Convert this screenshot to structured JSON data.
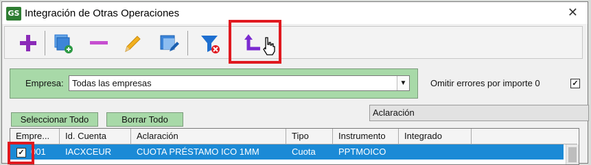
{
  "window": {
    "app_icon_text": "GS",
    "title": "Integración de Otras Operaciones",
    "close_glyph": "✕"
  },
  "toolbar": {
    "buttons": [
      {
        "name": "add",
        "icon": "plus-icon",
        "color": "#8b2bb8"
      },
      {
        "name": "duplicate",
        "icon": "copy-add-icon",
        "color": "#1e6fd0"
      },
      {
        "name": "remove",
        "icon": "minus-icon",
        "color": "#c64fd0"
      },
      {
        "name": "edit",
        "icon": "pencil-icon",
        "color": "#f2b01e"
      },
      {
        "name": "edit-record",
        "icon": "edit-document-icon",
        "color": "#1e6fd0"
      },
      {
        "name": "clear-filter",
        "icon": "filter-remove-icon",
        "color": "#1e6fd0"
      },
      {
        "name": "integrate",
        "icon": "return-arrow-icon",
        "color": "#7b2bd0"
      }
    ],
    "highlight_color": "#e0191f"
  },
  "filters": {
    "empresa_label": "Empresa:",
    "empresa_value": "Todas las empresas",
    "omit_errors_label": "Omitir errores por importe 0",
    "omit_errors_checked": true
  },
  "actions": {
    "select_all": "Seleccionar Todo",
    "clear_all": "Borrar Todo"
  },
  "aclaracion_field": {
    "value": "Aclaración"
  },
  "grid": {
    "columns": [
      "Empre...",
      "Id. Cuenta",
      "Aclaración",
      "Tipo",
      "Instrumento",
      "Integrado"
    ],
    "rows": [
      {
        "checked": true,
        "empresa": "001",
        "id_cuenta": "IACXCEUR",
        "aclaracion": "CUOTA PRÉSTAMO ICO 1MM",
        "tipo": "Cuota",
        "instrumento": "PPTMOICO",
        "integrado": ""
      }
    ],
    "selection_color": "#1b8ad6"
  }
}
